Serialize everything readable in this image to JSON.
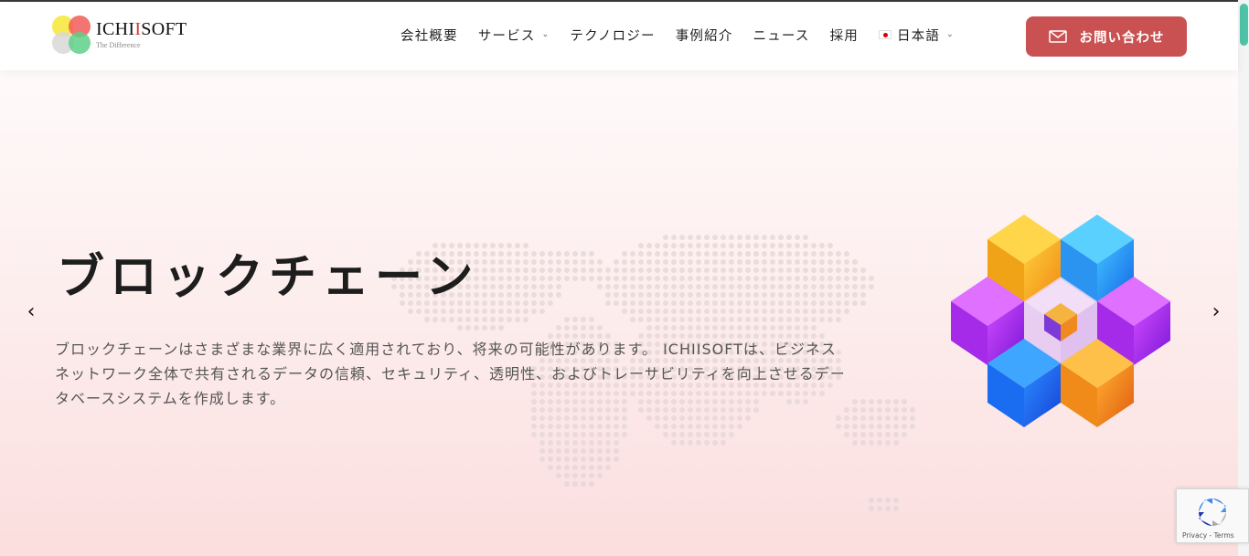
{
  "brand": {
    "name_prefix": "ICHI",
    "name_highlight": "I",
    "name_suffix": "SOFT",
    "tagline": "The Difference"
  },
  "nav": {
    "items": [
      {
        "label": "会社概要",
        "has_dropdown": false
      },
      {
        "label": "サービス",
        "has_dropdown": true
      },
      {
        "label": "テクノロジー",
        "has_dropdown": false
      },
      {
        "label": "事例紹介",
        "has_dropdown": false
      },
      {
        "label": "ニュース",
        "has_dropdown": false
      },
      {
        "label": "採用",
        "has_dropdown": false
      }
    ],
    "language": {
      "label": "日本語",
      "flag": "japan-flag-icon"
    },
    "chevron_glyph": "⌄"
  },
  "cta": {
    "label": "お問い合わせ",
    "icon": "mail-icon"
  },
  "hero": {
    "title": "ブロックチェーン",
    "description": "ブロックチェーンはさまざまな業界に広く適用されており、将来の可能性があります。 ICHIISOFTは、ビジネスネットワーク全体で共有されるデータの信頼、セキュリティ、透明性、およびトレーサビリティを向上させるデータベースシステムを作成します。",
    "prev_glyph": "‹",
    "next_glyph": "›"
  },
  "recaptcha": {
    "links": "Privacy - Terms"
  },
  "colors": {
    "cta": "#c95151",
    "scroll_thumb": "#4fc3a8",
    "hero_top": "#fffafa",
    "hero_bottom": "#fbdede"
  }
}
